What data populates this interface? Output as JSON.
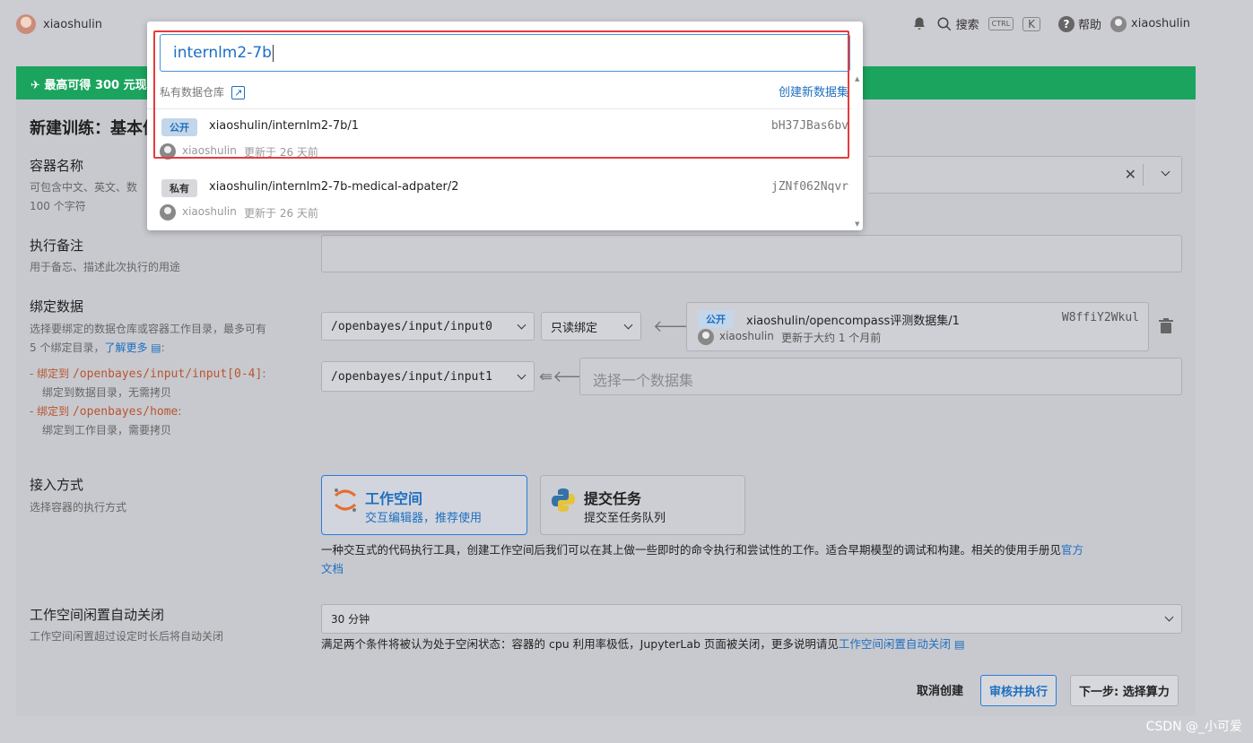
{
  "topbar": {
    "username_left": "xiaoshulin",
    "search_label": "搜索",
    "kbd1": "CTRL",
    "kbd2": "K",
    "help_label": "帮助",
    "username_right": "xiaoshulin"
  },
  "banner": {
    "text": "最高可得 300 元现"
  },
  "page_title": "新建训练：基本信",
  "container_name": {
    "label": "容器名称",
    "hint": "可包含中文、英文、数",
    "hint2": "100 个字符"
  },
  "remark": {
    "label": "执行备注",
    "hint": "用于备忘、描述此次执行的用途"
  },
  "bind": {
    "label": "绑定数据",
    "hint1": "选择要绑定的数据仓库或容器工作目录，最多可有",
    "hint2": "5 个绑定目录，",
    "learn_more": "了解更多",
    "rule1_prefix": "绑定到 ",
    "rule1_path": "/openbayes/input/input[0-4]",
    "rule1_desc": "绑定到数据目录，无需拷贝",
    "rule2_prefix": "绑定到 ",
    "rule2_path": "/openbayes/home",
    "rule2_desc": "绑定到工作目录，需要拷贝",
    "row1_path": "/openbayes/input/input0",
    "row1_mode": "只读绑定",
    "row1_tag": "公开",
    "row1_dataset": "xiaoshulin/opencompass评测数据集/1",
    "row1_hash": "W8ffiY2Wkul",
    "row1_user": "xiaoshulin",
    "row1_updated": "更新于大约 1 个月前",
    "row2_path": "/openbayes/input/input1",
    "row2_placeholder": "选择一个数据集"
  },
  "access": {
    "label": "接入方式",
    "hint": "选择容器的执行方式",
    "workspace_title": "工作空间",
    "workspace_sub": "交互编辑器，推荐使用",
    "task_title": "提交任务",
    "task_sub": "提交至任务队列",
    "desc": "一种交互式的代码执行工具，创建工作空间后我们可以在其上做一些即时的命令执行和尝试性的工作。适合早期模型的调试和构建。相关的使用手册见",
    "desc_link": "官方",
    "desc_link2": "文档"
  },
  "idle": {
    "label": "工作空间闲置自动关闭",
    "hint": "工作空间闲置超过设定时长后将自动关闭",
    "value": "30 分钟",
    "note": "满足两个条件将被认为处于空闲状态：容器的 cpu 利用率极低，JupyterLab 页面被关闭，更多说明请见",
    "note_link": "工作空间闲置自动关闭"
  },
  "actions": {
    "cancel": "取消创建",
    "review": "审核并执行",
    "next": "下一步: 选择算力"
  },
  "dropdown": {
    "search_value": "internlm2-7b",
    "section_label": "私有数据仓库",
    "create_link": "创建新数据集",
    "items": [
      {
        "tag": "公开",
        "name": "xiaoshulin/internlm2-7b/1",
        "hash": "bH37JBas6bv",
        "user": "xiaoshulin",
        "updated": "更新于 26 天前"
      },
      {
        "tag": "私有",
        "name": "xiaoshulin/internlm2-7b-medical-adpater/2",
        "hash": "jZNf062Nqvr",
        "user": "xiaoshulin",
        "updated": "更新于 26 天前"
      }
    ]
  },
  "watermark": "CSDN @_小可爱"
}
